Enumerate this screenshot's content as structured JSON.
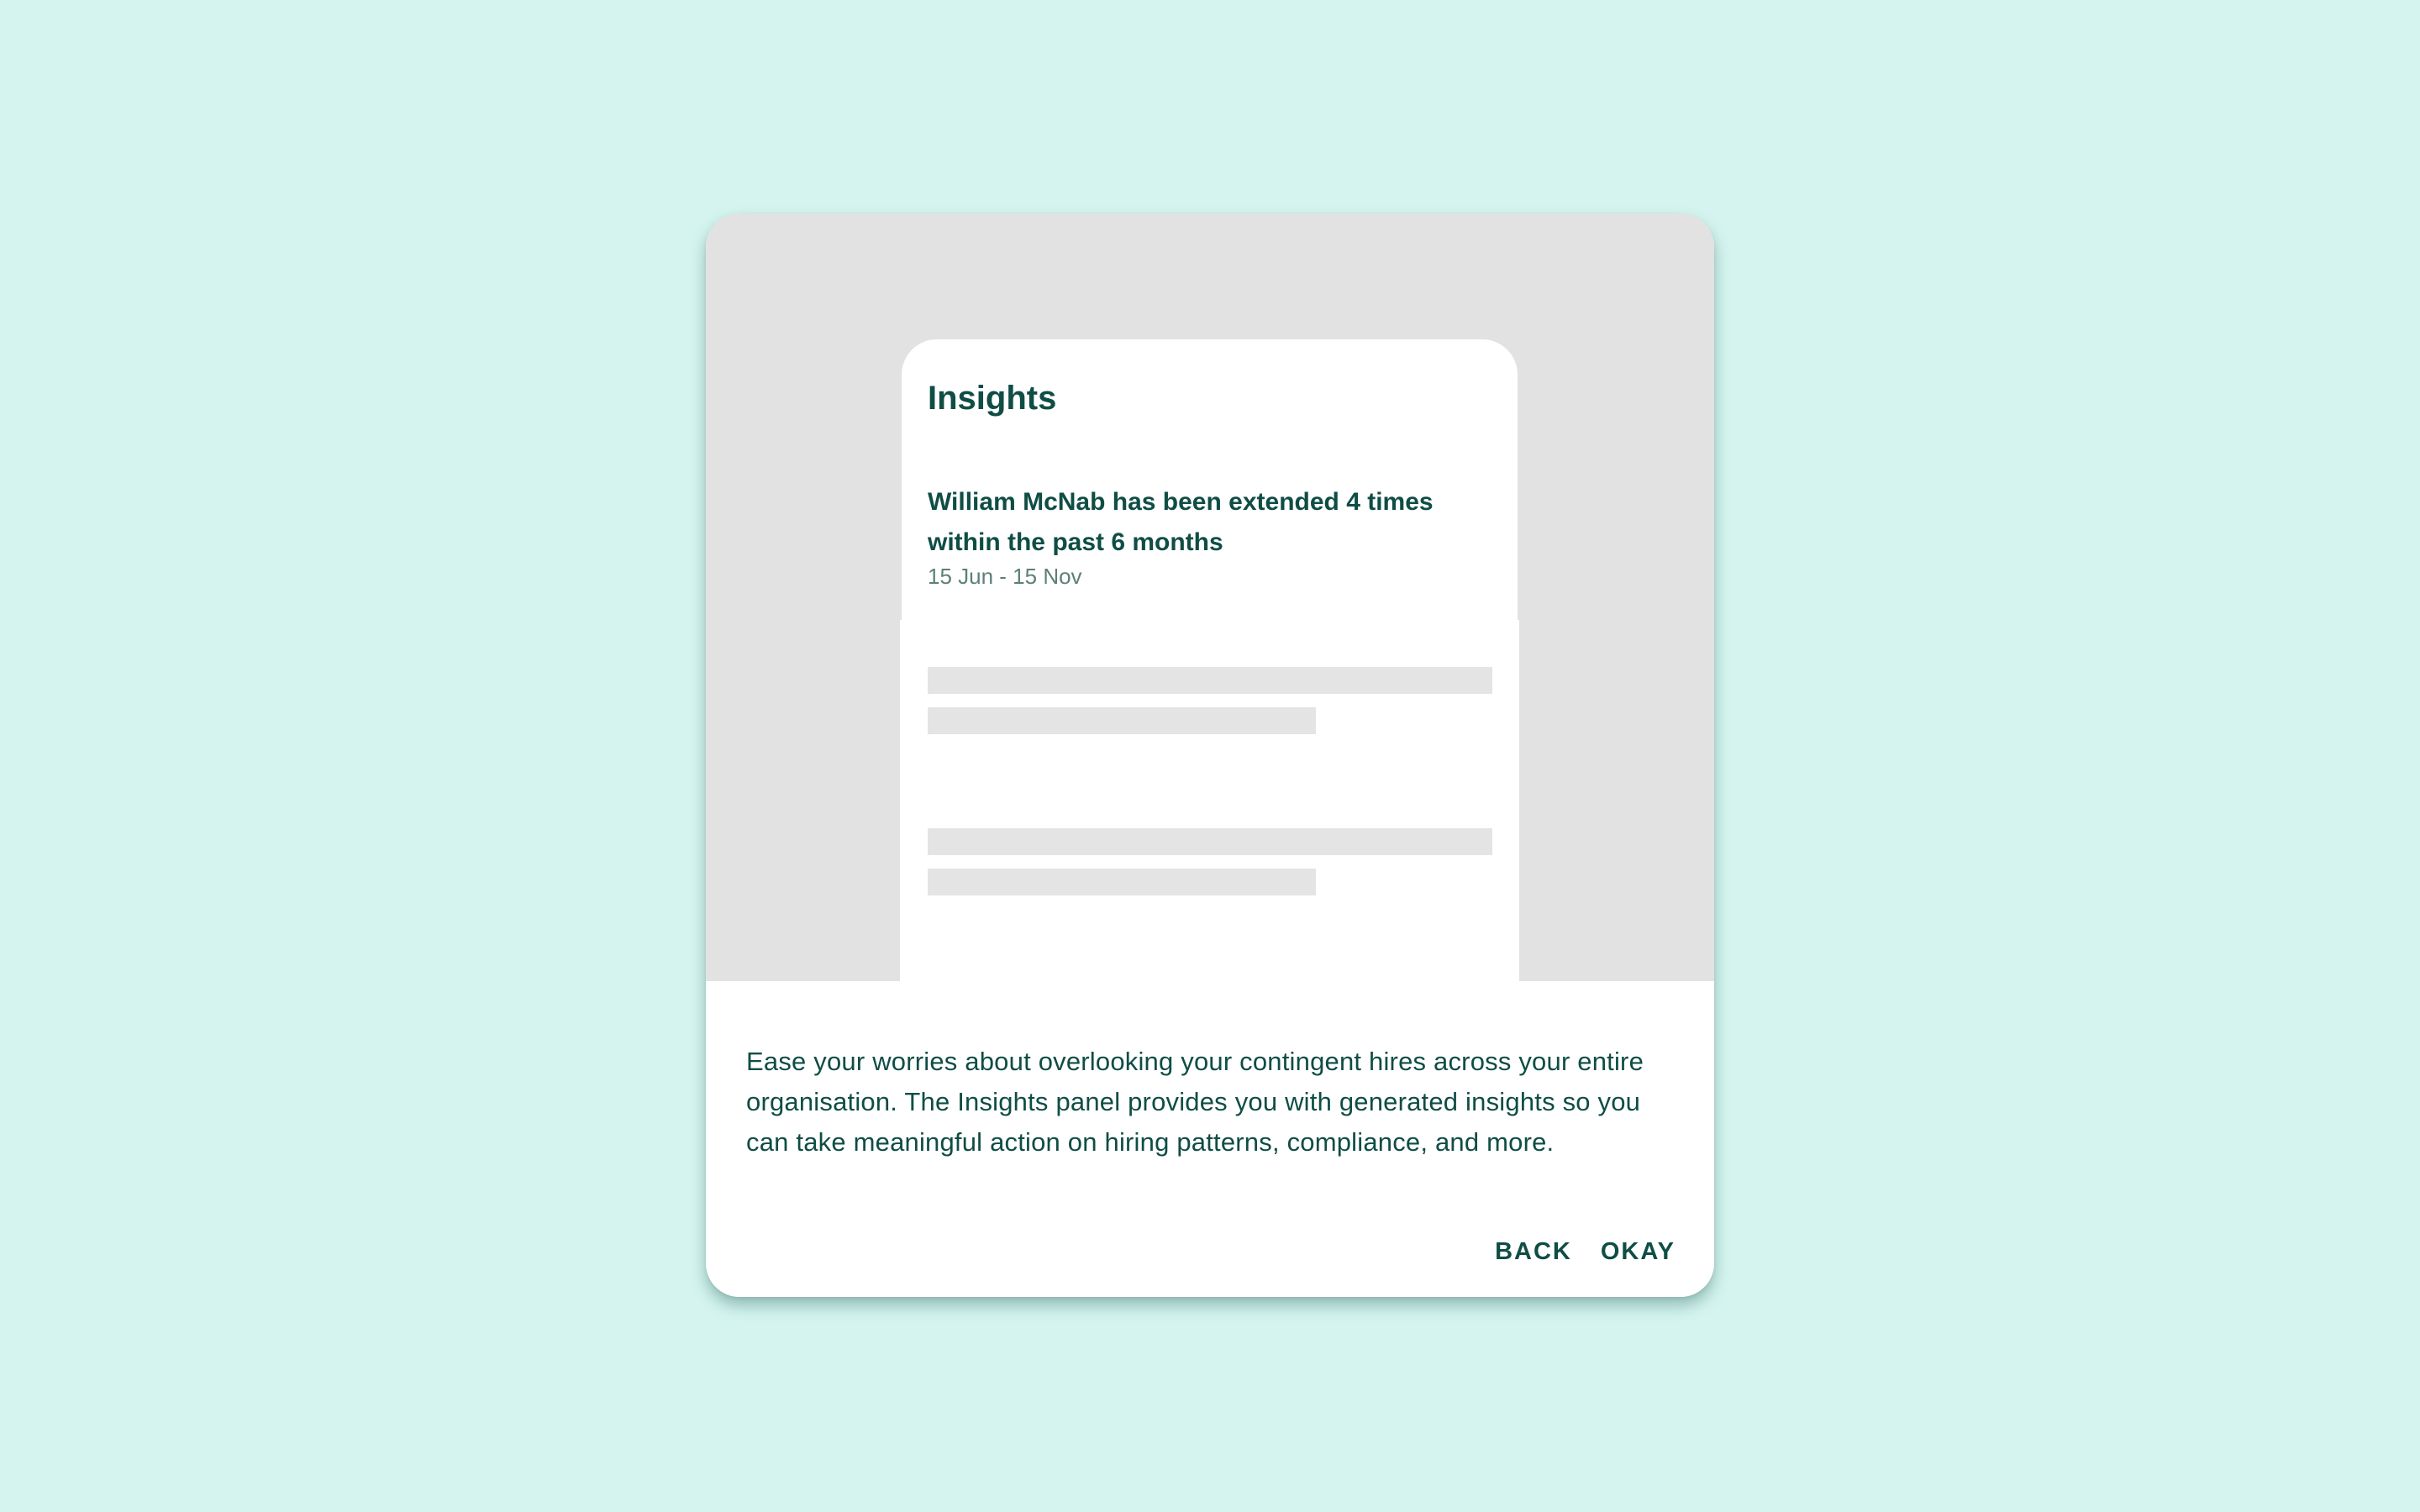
{
  "dialog": {
    "preview": {
      "panel_title": "Insights",
      "insight": {
        "text": "William McNab has been extended 4 times within the past 6 months",
        "date_range": "15 Jun - 15 Nov"
      }
    },
    "description": "Ease your worries about overlooking your contingent hires across your entire organisation. The Insights panel provides you with generated insights so you can take meaningful action on hiring patterns, compliance, and more.",
    "actions": {
      "back_label": "BACK",
      "okay_label": "OKAY"
    }
  },
  "colors": {
    "page_background": "#d5f4ef",
    "accent_text": "#0f4d45",
    "hero_background": "#e2e2e2",
    "skeleton": "#e4e4e4",
    "muted_text": "#5d7f79"
  }
}
